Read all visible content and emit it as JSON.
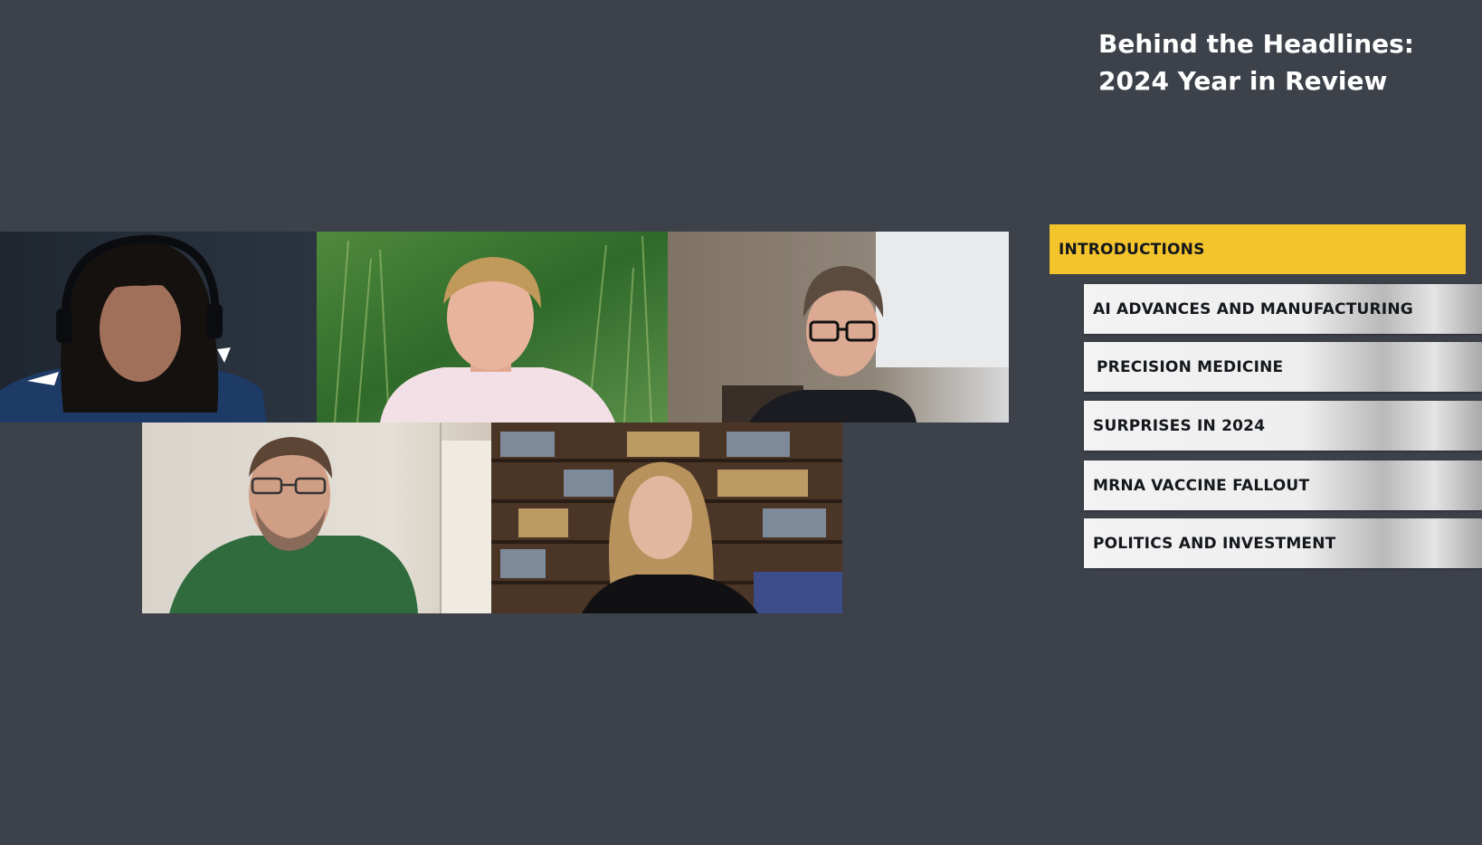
{
  "show": {
    "title_line1": "Behind the Headlines:",
    "title_line2": "2024 Year in Review"
  },
  "agenda": {
    "items": [
      {
        "label": "INTRODUCTIONS",
        "active": true
      },
      {
        "label": "AI ADVANCES AND MANUFACTURING",
        "active": false
      },
      {
        "label": "PRECISION MEDICINE",
        "active": false
      },
      {
        "label": "SURPRISES IN 2024",
        "active": false
      },
      {
        "label": "MRNA VACCINE FALLOUT",
        "active": false
      },
      {
        "label": "POLITICS AND INVESTMENT",
        "active": false
      }
    ]
  },
  "colors": {
    "background": "#3c414a",
    "active_accent": "#f4c42c",
    "title_text": "#ffffff"
  },
  "participants": [
    {
      "tile": "participant-video-1",
      "icon": "headset-speaker-video"
    },
    {
      "tile": "participant-video-2",
      "icon": "grass-background-video"
    },
    {
      "tile": "participant-video-3",
      "icon": "glasses-speaker-video"
    },
    {
      "tile": "participant-video-4",
      "icon": "green-polo-speaker-video"
    },
    {
      "tile": "participant-video-5",
      "icon": "library-background-video"
    }
  ]
}
